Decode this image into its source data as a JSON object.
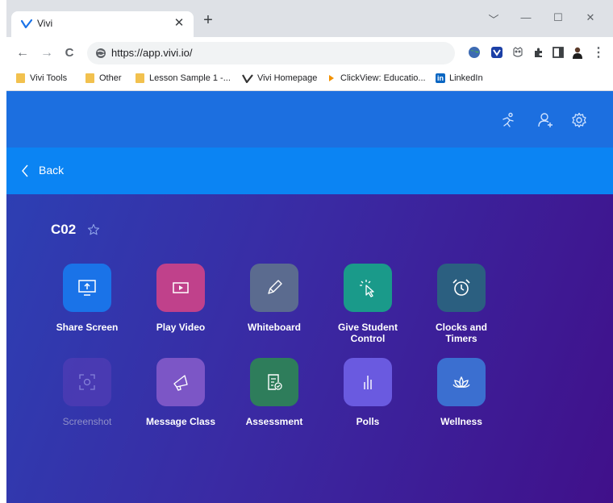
{
  "browser": {
    "tab_title": "Vivi",
    "tab_close": "✕",
    "new_tab": "+",
    "window_controls": [
      "﹀",
      "—",
      "☐",
      "✕"
    ],
    "back": "←",
    "forward": "→",
    "reload": "C",
    "url": "https://app.vivi.io/",
    "extensions": [
      "globe-icon",
      "vivi-extension-icon",
      "owl-extension-icon",
      "puzzle-icon",
      "side-panel-icon",
      "profile-avatar",
      "menu-icon"
    ],
    "menu": "⋮"
  },
  "bookmarks": [
    {
      "label": "Vivi Tools",
      "icon": "folder-icon"
    },
    {
      "label": "Other",
      "icon": "folder-icon"
    },
    {
      "label": "Lesson Sample 1 -...",
      "icon": "folder-icon"
    },
    {
      "label": "Vivi Homepage",
      "icon": "vivi-logo-icon"
    },
    {
      "label": "ClickView: Educatio...",
      "icon": "clickview-icon"
    },
    {
      "label": "LinkedIn",
      "icon": "linkedin-icon"
    }
  ],
  "linkedin_glyph": "in",
  "header": {
    "icons": [
      "activity-icon",
      "add-user-icon",
      "settings-icon"
    ]
  },
  "backbar": {
    "label": "Back"
  },
  "room": {
    "title": "C02"
  },
  "tiles": [
    {
      "label": "Share Screen",
      "icon": "share-screen-icon",
      "color": "#1a73e8",
      "enabled": true
    },
    {
      "label": "Play Video",
      "icon": "play-video-icon",
      "color": "#c0418b",
      "enabled": true
    },
    {
      "label": "Whiteboard",
      "icon": "pencil-icon",
      "color": "#5b6b8f",
      "enabled": true
    },
    {
      "label": "Give Student Control",
      "icon": "pointer-icon",
      "color": "#1a9a8a",
      "enabled": true
    },
    {
      "label": "Clocks and Timers",
      "icon": "alarm-clock-icon",
      "color": "#2b5f80",
      "enabled": true
    },
    {
      "label": "Screenshot",
      "icon": "screenshot-icon",
      "color": "#5b3fb8",
      "enabled": false
    },
    {
      "label": "Message Class",
      "icon": "megaphone-icon",
      "color": "#7c56c6",
      "enabled": true
    },
    {
      "label": "Assessment",
      "icon": "assessment-icon",
      "color": "#2e7d5b",
      "enabled": true
    },
    {
      "label": "Polls",
      "icon": "bar-chart-icon",
      "color": "#6a5ae0",
      "enabled": true
    },
    {
      "label": "Wellness",
      "icon": "lotus-icon",
      "color": "#3b6fd0",
      "enabled": true
    }
  ]
}
